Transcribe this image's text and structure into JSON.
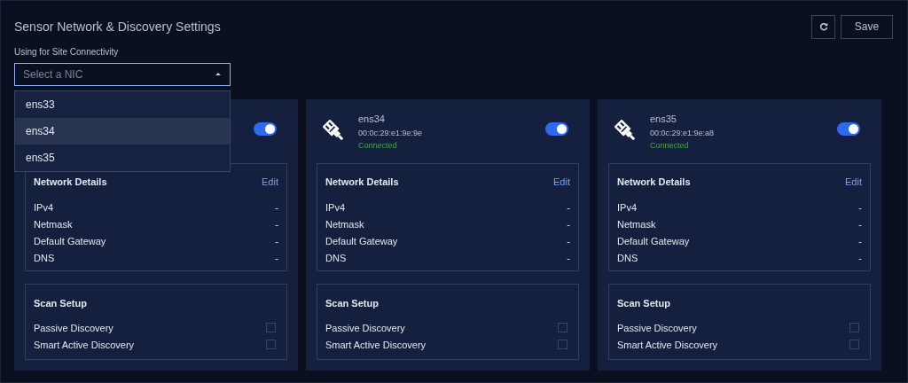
{
  "title": "Sensor Network & Discovery Settings",
  "actions": {
    "save": "Save"
  },
  "nic_select": {
    "label": "Using for Site Connectivity",
    "placeholder": "Select a NIC",
    "expanded": true,
    "options": [
      {
        "label": "ens33",
        "selected": false
      },
      {
        "label": "ens34",
        "selected": true
      },
      {
        "label": "ens35",
        "selected": false
      }
    ]
  },
  "cards": [
    {
      "on": true,
      "details": {
        "title": "Network Details",
        "edit": "Edit",
        "rows": [
          {
            "label": "IPv4",
            "value": "-"
          },
          {
            "label": "Netmask",
            "value": "-"
          },
          {
            "label": "Default Gateway",
            "value": "-"
          },
          {
            "label": "DNS",
            "value": "-"
          }
        ]
      },
      "scan": {
        "title": "Scan Setup",
        "options": [
          {
            "label": "Passive Discovery",
            "checked": false
          },
          {
            "label": "Smart Active Discovery",
            "checked": false
          }
        ]
      }
    },
    {
      "name": "ens34",
      "mac": "00:0c:29:e1:9e:9e",
      "status": "Connected",
      "on": true,
      "details": {
        "title": "Network Details",
        "edit": "Edit",
        "rows": [
          {
            "label": "IPv4",
            "value": "-"
          },
          {
            "label": "Netmask",
            "value": "-"
          },
          {
            "label": "Default Gateway",
            "value": "-"
          },
          {
            "label": "DNS",
            "value": "-"
          }
        ]
      },
      "scan": {
        "title": "Scan Setup",
        "options": [
          {
            "label": "Passive Discovery",
            "checked": false
          },
          {
            "label": "Smart Active Discovery",
            "checked": false
          }
        ]
      }
    },
    {
      "name": "ens35",
      "mac": "00:0c:29:e1:9e:a8",
      "status": "Connected",
      "on": true,
      "details": {
        "title": "Network Details",
        "edit": "Edit",
        "rows": [
          {
            "label": "IPv4",
            "value": "-"
          },
          {
            "label": "Netmask",
            "value": "-"
          },
          {
            "label": "Default Gateway",
            "value": "-"
          },
          {
            "label": "DNS",
            "value": "-"
          }
        ]
      },
      "scan": {
        "title": "Scan Setup",
        "options": [
          {
            "label": "Passive Discovery",
            "checked": false
          },
          {
            "label": "Smart Active Discovery",
            "checked": false
          }
        ]
      }
    }
  ]
}
